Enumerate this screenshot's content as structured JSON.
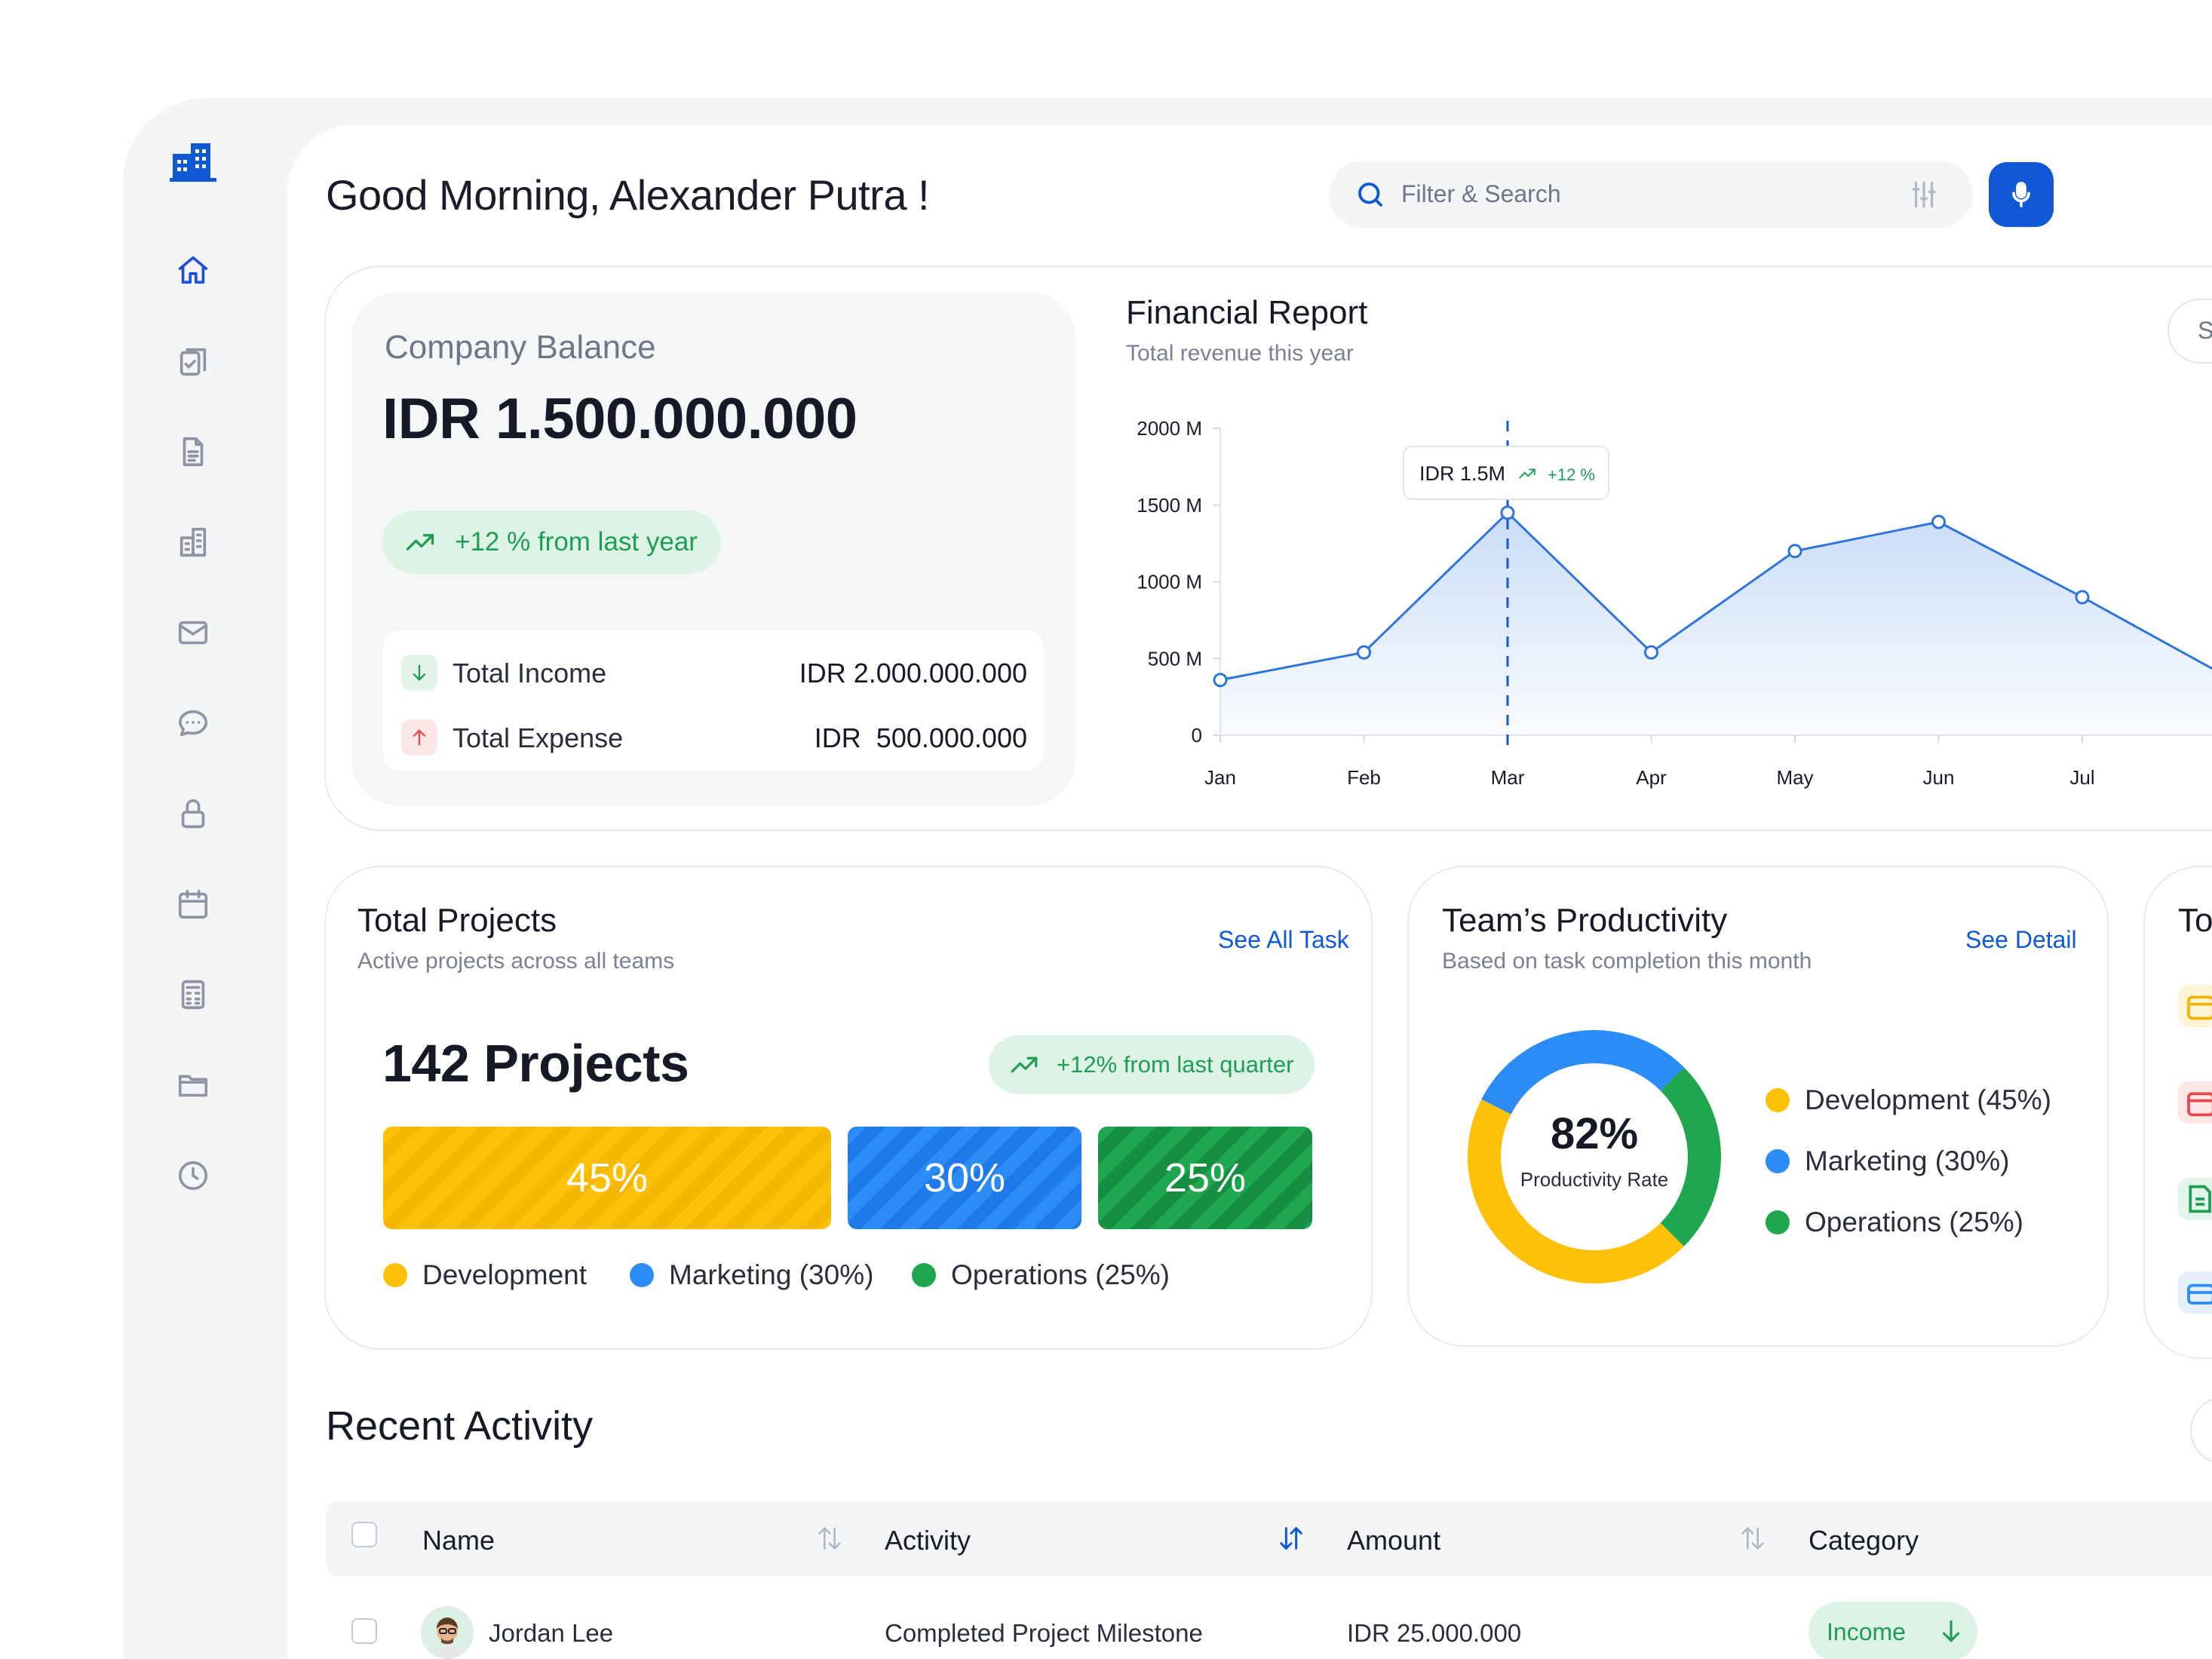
{
  "header": {
    "greeting": "Good Morning, Alexander Putra !",
    "search_placeholder": "Filter & Search"
  },
  "sidebar": {
    "items": [
      {
        "icon": "home-icon",
        "active": true
      },
      {
        "icon": "clipboard-check-icon"
      },
      {
        "icon": "document-icon"
      },
      {
        "icon": "building-icon"
      },
      {
        "icon": "mail-icon"
      },
      {
        "icon": "chat-icon"
      },
      {
        "icon": "lock-icon"
      },
      {
        "icon": "calendar-icon"
      },
      {
        "icon": "calculator-icon"
      },
      {
        "icon": "folder-icon"
      },
      {
        "icon": "clock-icon"
      }
    ]
  },
  "balance": {
    "label": "Company Balance",
    "amount": "IDR 1.500.000.000",
    "growth": "+12 % from last year",
    "income_label": "Total Income",
    "income_value": "IDR 2.000.000.000",
    "expense_label": "Total Expense",
    "expense_value": "IDR  500.000.000"
  },
  "financial_report": {
    "title": "Financial Report",
    "subtitle": "Total revenue this year",
    "chip_label": "S",
    "tooltip_value": "IDR 1.5M",
    "tooltip_delta": "+12 %"
  },
  "chart_data": {
    "type": "area",
    "categories": [
      "Jan",
      "Feb",
      "Mar",
      "Apr",
      "May",
      "Jun",
      "Jul"
    ],
    "series": [
      {
        "values": [
          360,
          540,
          1450,
          540,
          1200,
          1390,
          900
        ]
      }
    ],
    "y_ticks": [
      "2000 M",
      "1500 M",
      "1000 M",
      "500 M",
      "0"
    ],
    "ylim": [
      0,
      2000
    ],
    "highlight_category": "Mar",
    "colors": {
      "line": "#2f74d8",
      "fill": "#c7dbf6"
    }
  },
  "projects": {
    "title": "Total Projects",
    "subtitle": "Active projects across all teams",
    "link": "See All Task",
    "count": "142 Projects",
    "growth": "+12% from last quarter",
    "segments": [
      {
        "label": "45%",
        "color": "#ffc107"
      },
      {
        "label": "30%",
        "color": "#2b8cf7"
      },
      {
        "label": "25%",
        "color": "#1ea74f"
      }
    ],
    "legend": [
      "Development",
      "Marketing (30%)",
      "Operations (25%)"
    ]
  },
  "productivity": {
    "title": "Team’s Productivity",
    "subtitle": "Based on task completion this month",
    "link": "See Detail",
    "rate": "82%",
    "rate_label": "Productivity Rate",
    "legend": [
      "Development (45%)",
      "Marketing (30%)",
      "Operations (25%)"
    ],
    "shares": [
      45,
      30,
      25
    ],
    "colors": [
      "#ffc107",
      "#2b8cf7",
      "#1ea74f"
    ]
  },
  "tasks_card": {
    "title_fragment": "To"
  },
  "recent_activity": {
    "title": "Recent Activity",
    "columns": [
      "Name",
      "Activity",
      "Amount",
      "Category"
    ],
    "rows": [
      {
        "name": "Jordan Lee",
        "activity": "Completed Project Milestone",
        "amount": "IDR 25.000.000",
        "category": "Income"
      }
    ]
  }
}
